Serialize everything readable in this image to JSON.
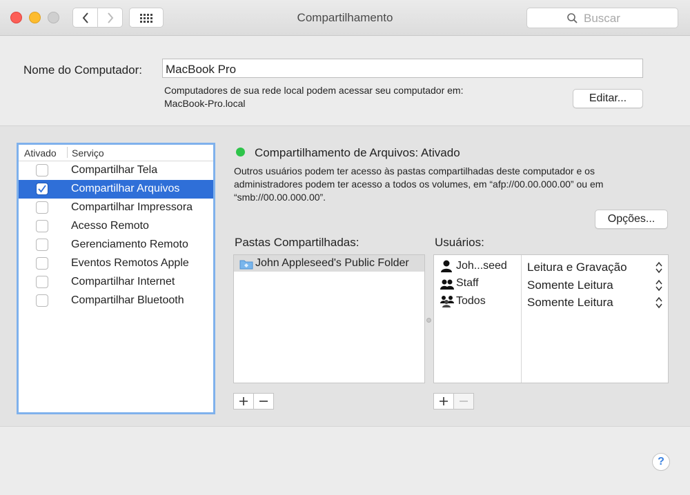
{
  "window": {
    "title": "Compartilhamento",
    "search_placeholder": "Buscar"
  },
  "computer_name": {
    "label": "Nome do Computador:",
    "value": "MacBook Pro",
    "info_line1": "Computadores de sua rede local podem acessar seu computador em:",
    "info_line2": "MacBook-Pro.local",
    "edit_button": "Editar..."
  },
  "services": {
    "header_enabled": "Ativado",
    "header_service": "Serviço",
    "items": [
      {
        "label": "Compartilhar Tela",
        "checked": false
      },
      {
        "label": "Compartilhar Arquivos",
        "checked": true
      },
      {
        "label": "Compartilhar Impressora",
        "checked": false
      },
      {
        "label": "Acesso Remoto",
        "checked": false
      },
      {
        "label": "Gerenciamento Remoto",
        "checked": false
      },
      {
        "label": "Eventos Remotos Apple",
        "checked": false
      },
      {
        "label": "Compartilhar Internet",
        "checked": false
      },
      {
        "label": "Compartilhar Bluetooth",
        "checked": false
      }
    ]
  },
  "detail": {
    "status": "Compartilhamento de Arquivos: Ativado",
    "status_color": "#2ec44a",
    "description_line1": "Outros usuários podem ter acesso às pastas compartilhadas deste computador e os",
    "description_line2": "administradores podem ter acesso a todos os volumes, em “afp://00.00.000.00” ou em",
    "description_line3": "“smb://00.00.000.00”.",
    "options_button": "Opções..."
  },
  "shared_folders": {
    "label": "Pastas Compartilhadas:",
    "items": [
      "John Appleseed's Public Folder"
    ],
    "add": "+",
    "remove": "−"
  },
  "users": {
    "label": "Usuários:",
    "items": [
      {
        "name": "Joh...seed",
        "permission": "Leitura e Gravação",
        "icon": "single-user-icon"
      },
      {
        "name": "Staff",
        "permission": "Somente Leitura",
        "icon": "group-icon"
      },
      {
        "name": "Todos",
        "permission": "Somente Leitura",
        "icon": "everyone-icon"
      }
    ],
    "add": "+",
    "remove": "−"
  },
  "help": "?",
  "accent_color": "#2f6fd8"
}
